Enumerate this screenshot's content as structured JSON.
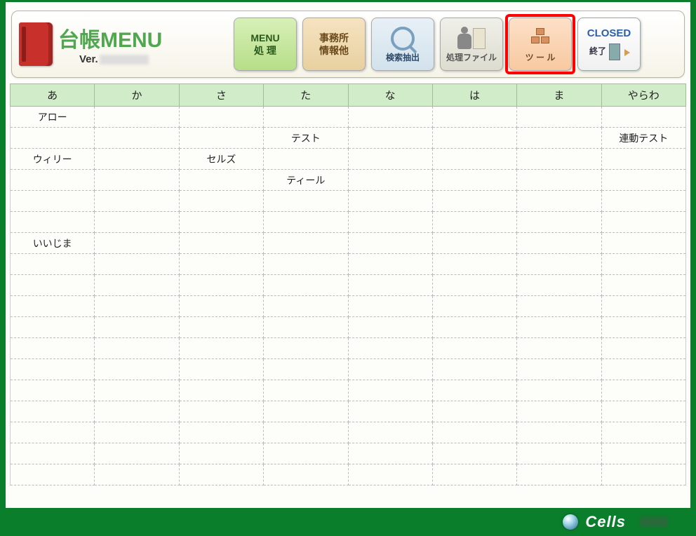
{
  "header": {
    "title": "台帳MENU",
    "version_label": "Ver."
  },
  "buttons": {
    "menu_processing": "MENU\n処 理",
    "office_info": "事務所\n情報他",
    "search_extract": "検索抽出",
    "process_file": "処理ファイル",
    "tool": "ツ ー ル",
    "closed": "CLOSED",
    "exit": "終了"
  },
  "tabs": [
    "あ",
    "か",
    "さ",
    "た",
    "な",
    "は",
    "ま",
    "やらわ"
  ],
  "grid_rows": [
    {
      "0": "アロー"
    },
    {
      "3": "テスト",
      "7": "連動テスト"
    },
    {
      "0": "ウィリー",
      "2": "セルズ"
    },
    {
      "3": "ティール"
    },
    {},
    {},
    {
      "0": "いいじま"
    },
    {},
    {},
    {},
    {},
    {},
    {},
    {},
    {},
    {},
    {},
    {}
  ],
  "footer": {
    "brand": "Cells"
  }
}
